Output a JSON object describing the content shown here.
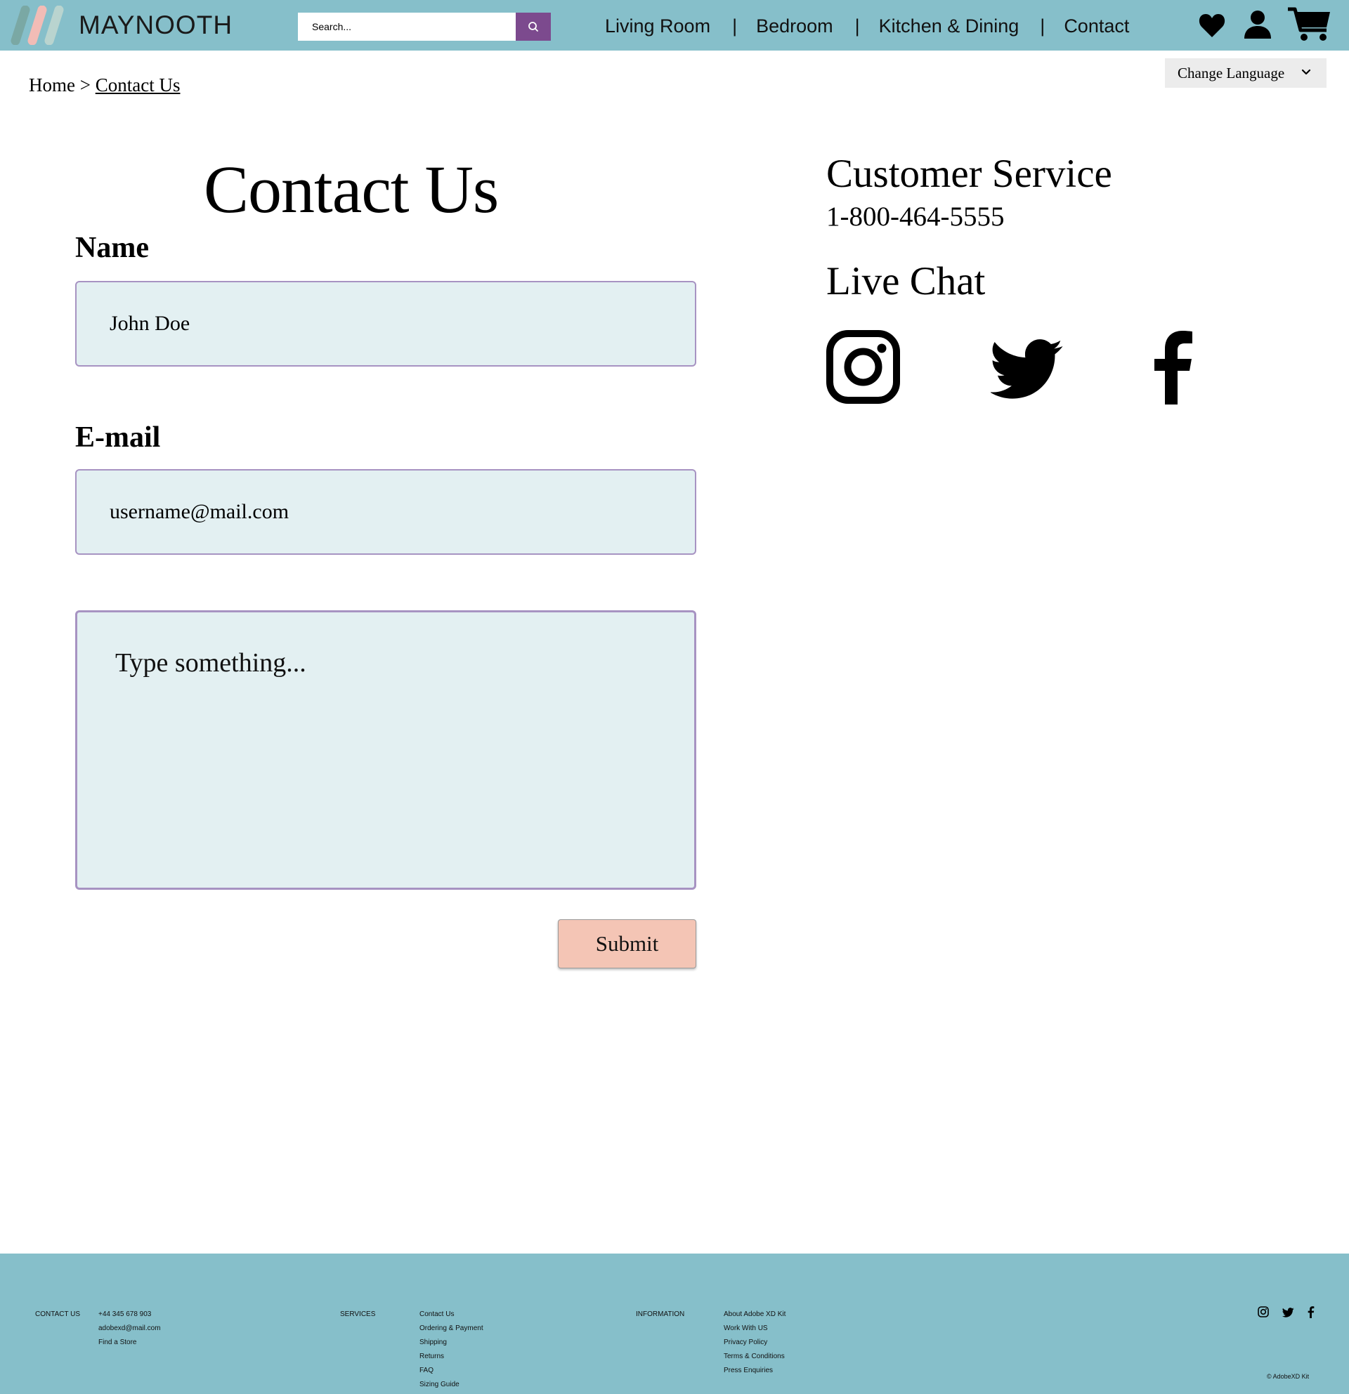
{
  "header": {
    "brand": "MAYNOOTH",
    "search": {
      "placeholder": "Search..."
    },
    "nav": [
      "Living Room",
      "Bedroom",
      "Kitchen & Dining",
      "Contact"
    ],
    "nav_separator": "|",
    "icons": [
      "heart-icon",
      "user-icon",
      "cart-icon"
    ],
    "colors": {
      "bar": "#86bfca",
      "search_button": "#7c4a8e"
    }
  },
  "breadcrumb": {
    "home": "Home",
    "separator": ">",
    "current": "Contact Us"
  },
  "language": {
    "label": "Change Language"
  },
  "form": {
    "title": "Contact Us",
    "name_label": "Name",
    "name_value": "John Doe",
    "email_label": "E-mail",
    "email_value": "username@mail.com",
    "message_placeholder": "Type something...",
    "submit_label": "Submit",
    "colors": {
      "field_bg": "#e3f0f2",
      "field_border": "#a793c2",
      "submit_bg": "#f4c5b5"
    }
  },
  "customer_service": {
    "title": "Customer Service",
    "phone": "1-800-464-5555",
    "live_chat": "Live Chat",
    "social": [
      "instagram-icon",
      "twitter-icon",
      "facebook-icon"
    ]
  },
  "footer": {
    "contact": {
      "heading": "CONTACT US",
      "items": [
        "+44 345 678 903",
        "adobexd@mail.com",
        "Find a Store"
      ]
    },
    "services": {
      "heading": "SERVICES",
      "items": [
        "Contact Us",
        "Ordering & Payment",
        "Shipping",
        "Returns",
        "FAQ",
        "Sizing Guide"
      ]
    },
    "information": {
      "heading": "INFORMATION",
      "items": [
        "About Adobe XD Kit",
        "Work With US",
        "Privacy Policy",
        "Terms & Conditions",
        "Press Enquiries"
      ]
    },
    "social": [
      "instagram-icon",
      "twitter-icon",
      "facebook-icon"
    ],
    "copyright": "© AdobeXD Kit"
  }
}
